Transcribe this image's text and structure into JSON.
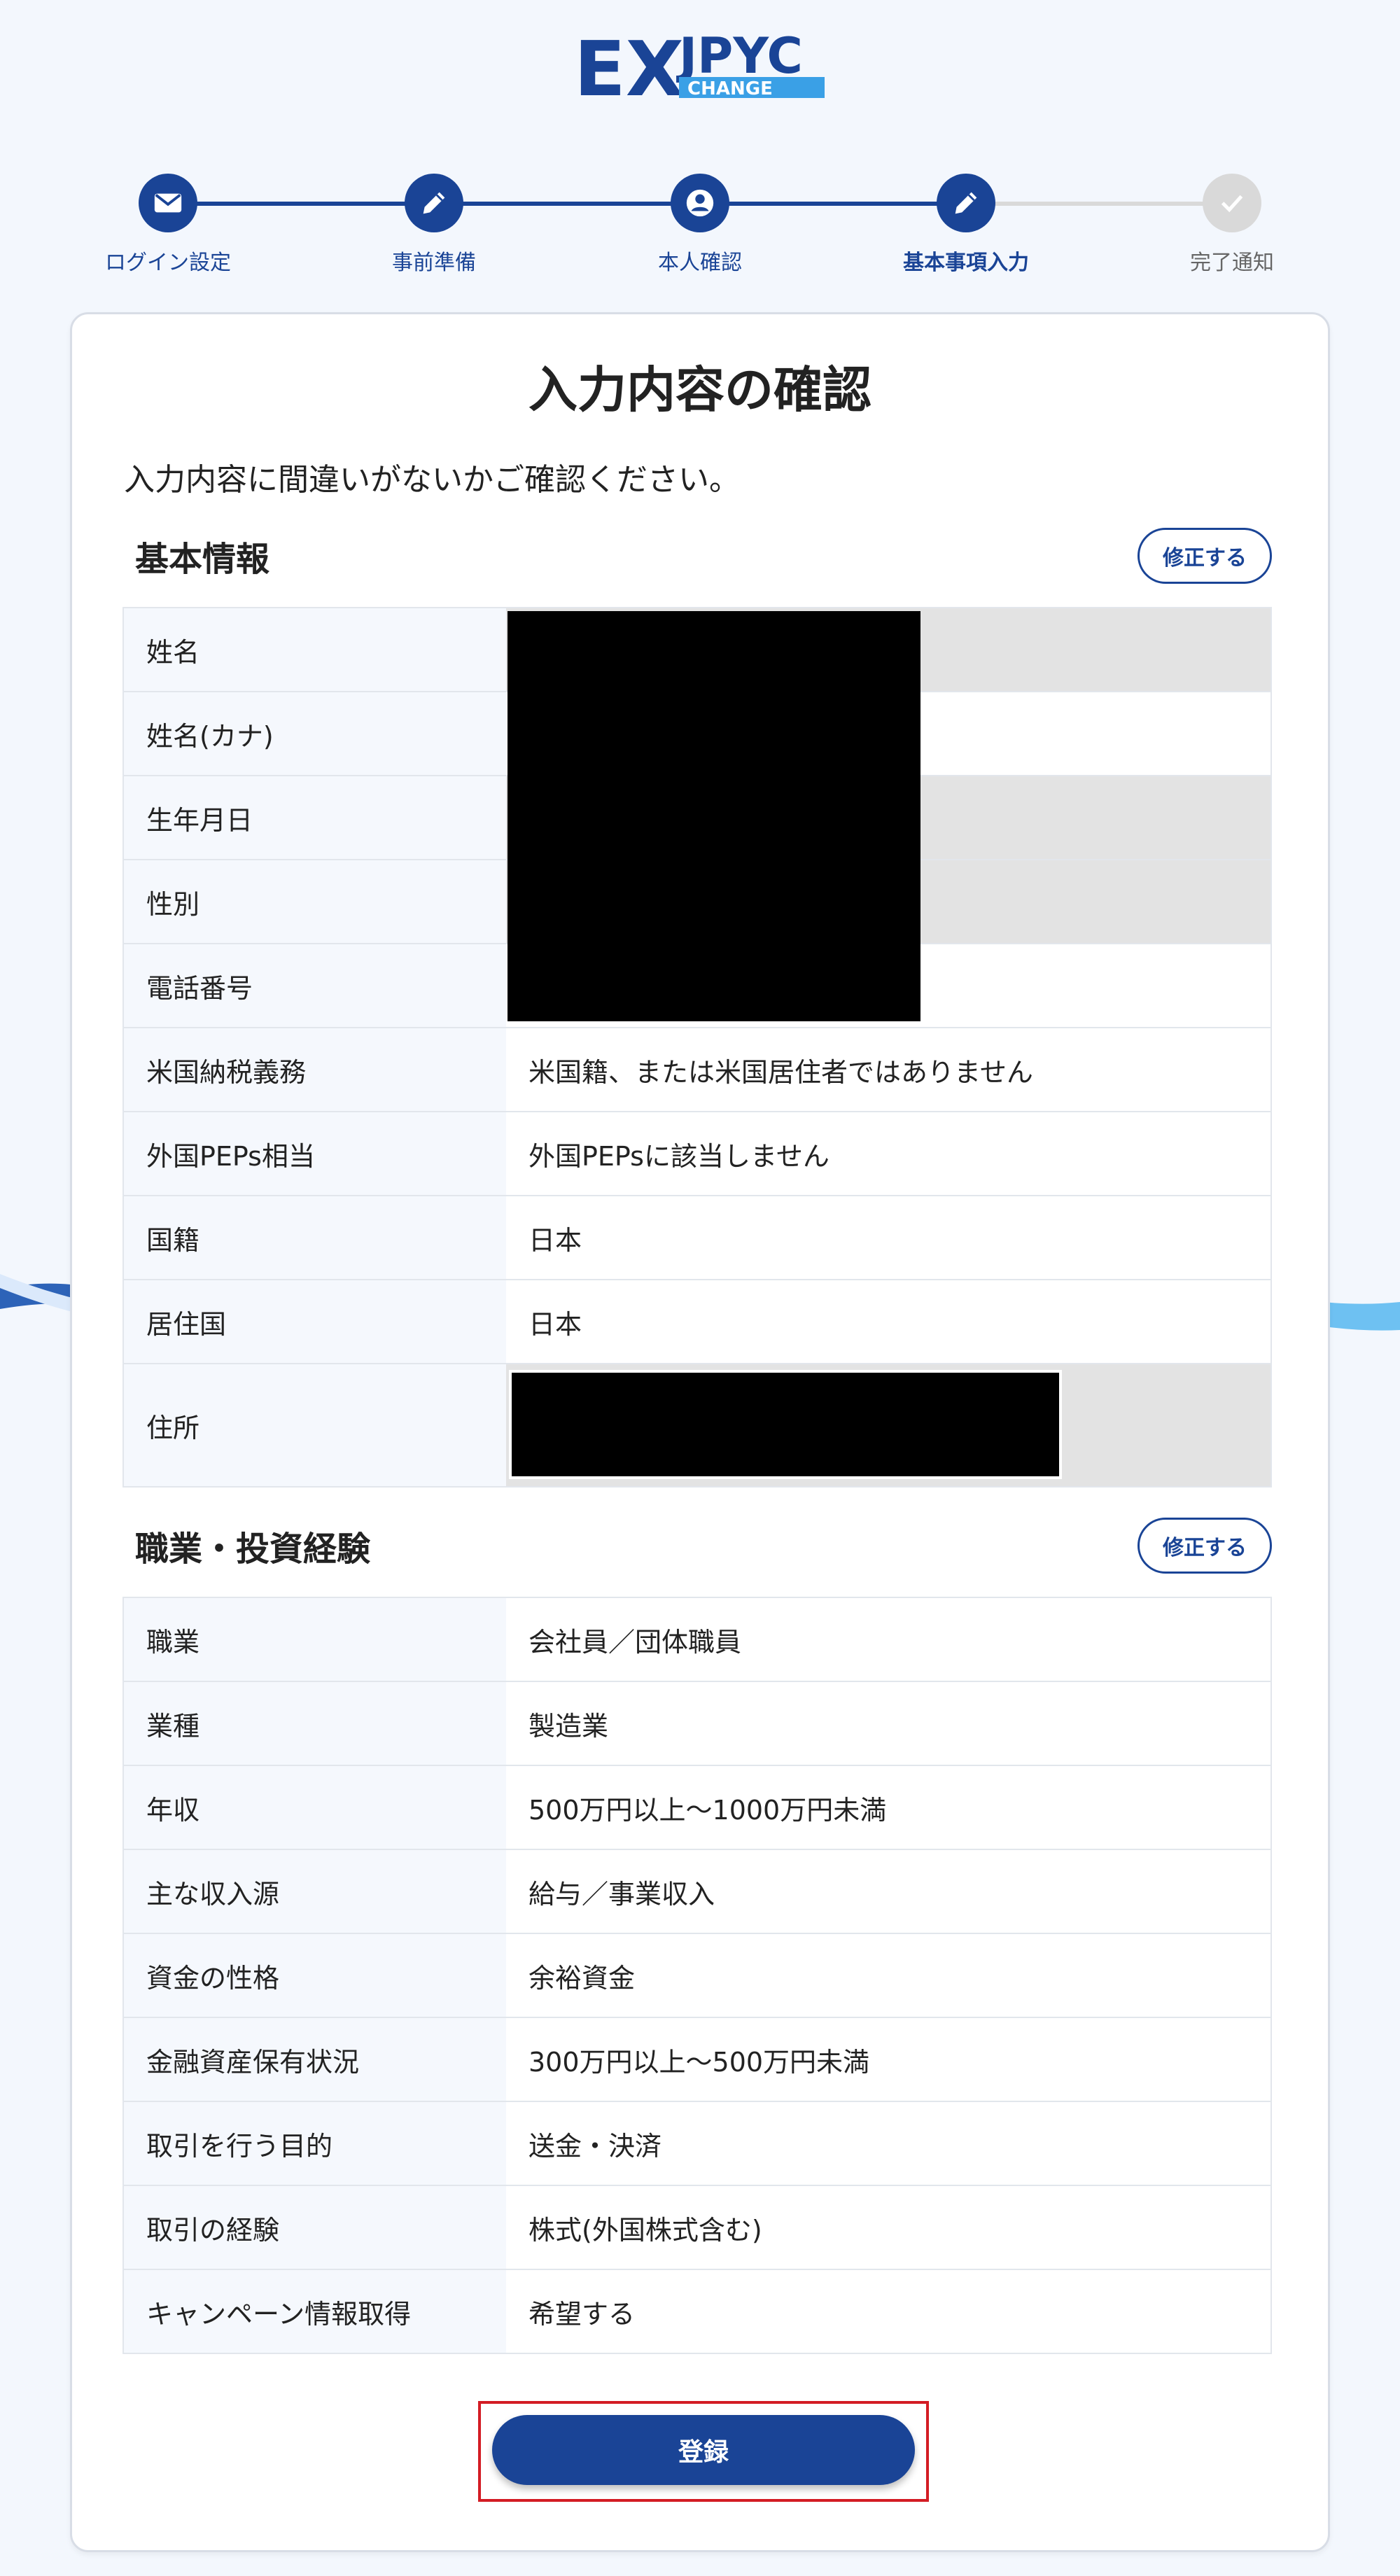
{
  "brand": {
    "logo_ex": "EX",
    "logo_jpyc": "JPYC",
    "logo_change": "CHANGE"
  },
  "stepper": {
    "steps": [
      {
        "label": "ログイン設定",
        "icon": "mail-icon",
        "state": "done"
      },
      {
        "label": "事前準備",
        "icon": "pencil-icon",
        "state": "done"
      },
      {
        "label": "本人確認",
        "icon": "person-icon",
        "state": "done"
      },
      {
        "label": "基本事項入力",
        "icon": "pencil-icon",
        "state": "current"
      },
      {
        "label": "完了通知",
        "icon": "check-icon",
        "state": "pending"
      }
    ]
  },
  "page": {
    "title": "入力内容の確認",
    "description": "入力内容に間違いがないかご確認ください。"
  },
  "basic_info": {
    "heading": "基本情報",
    "edit_label": "修正する",
    "rows": [
      {
        "label": "姓名",
        "value": ""
      },
      {
        "label": "姓名(カナ)",
        "value": ""
      },
      {
        "label": "生年月日",
        "value": ""
      },
      {
        "label": "性別",
        "value": ""
      },
      {
        "label": "電話番号",
        "value": ""
      },
      {
        "label": "米国納税義務",
        "value": "米国籍、または米国居住者ではありません"
      },
      {
        "label": "外国PEPs相当",
        "value": "外国PEPsに該当しません"
      },
      {
        "label": "国籍",
        "value": "日本"
      },
      {
        "label": "居住国",
        "value": "日本"
      },
      {
        "label": "住所",
        "value": ""
      }
    ]
  },
  "occupation": {
    "heading": "職業・投資経験",
    "edit_label": "修正する",
    "rows": [
      {
        "label": "職業",
        "value": "会社員／団体職員"
      },
      {
        "label": "業種",
        "value": "製造業"
      },
      {
        "label": "年収",
        "value": "500万円以上〜1000万円未満"
      },
      {
        "label": "主な収入源",
        "value": "給与／事業収入"
      },
      {
        "label": "資金の性格",
        "value": "余裕資金"
      },
      {
        "label": "金融資産保有状況",
        "value": "300万円以上〜500万円未満"
      },
      {
        "label": "取引を行う目的",
        "value": "送金・決済"
      },
      {
        "label": "取引の経験",
        "value": "株式(外国株式含む)"
      },
      {
        "label": "キャンペーン情報取得",
        "value": "希望する"
      }
    ]
  },
  "actions": {
    "submit_label": "登録"
  },
  "colors": {
    "primary": "#1a4496",
    "highlight": "#d31c24",
    "pending": "#d9d9d9"
  }
}
